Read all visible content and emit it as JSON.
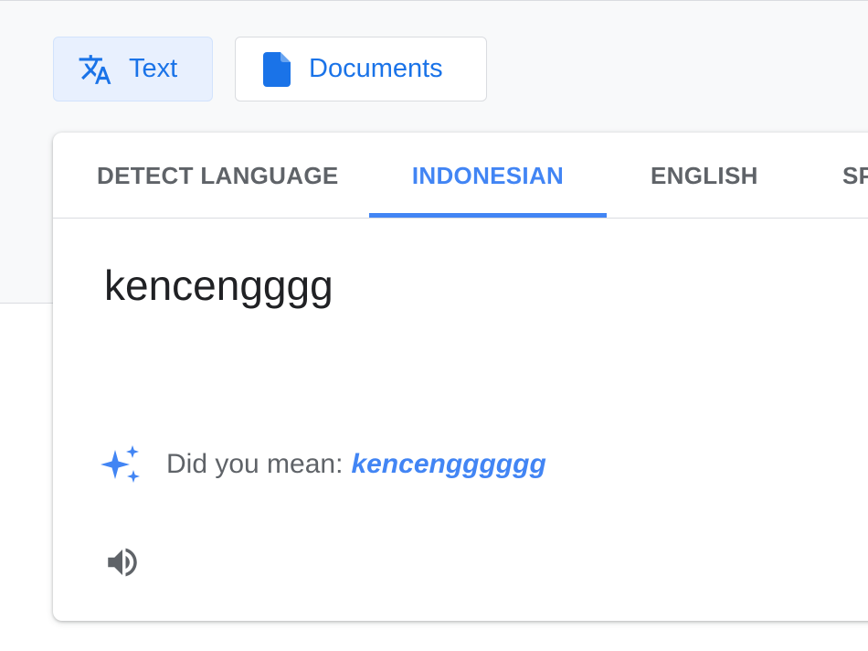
{
  "modes": {
    "text_label": "Text",
    "documents_label": "Documents",
    "text_icon": "translate-icon",
    "documents_icon": "document-icon"
  },
  "language_tabs": [
    {
      "label": "DETECT LANGUAGE",
      "selected": false
    },
    {
      "label": "INDONESIAN",
      "selected": true
    },
    {
      "label": "ENGLISH",
      "selected": false
    },
    {
      "label": "SP",
      "selected": false
    }
  ],
  "source": {
    "text": "kencengggg"
  },
  "suggestion": {
    "prompt": "Did you mean:",
    "suggested_text": "kencengggggg",
    "icon": "sparkle-icon"
  },
  "controls": {
    "listen_icon": "speaker-icon"
  },
  "colors": {
    "accent": "#4285f4",
    "button_blue": "#1a73e8",
    "selected_mode_bg": "#e8f0fe",
    "text_primary": "#202124",
    "text_secondary": "#5f6368",
    "band_bg": "#f8f9fa"
  }
}
